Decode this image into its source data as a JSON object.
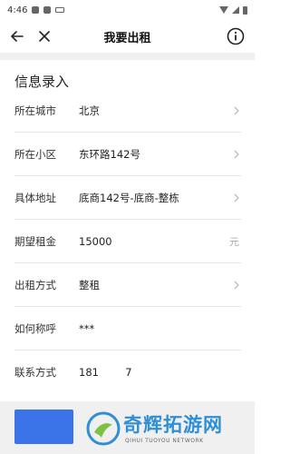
{
  "status_bar": {
    "time": "4:46"
  },
  "header": {
    "title": "我要出租"
  },
  "form": {
    "section_title": "信息录入",
    "rows": [
      {
        "label": "所在城市",
        "value": "北京",
        "has_chevron": true
      },
      {
        "label": "所在小区",
        "value": "东环路142号",
        "has_chevron": true
      },
      {
        "label": "具体地址",
        "value": "底商142号-底商-整栋",
        "has_chevron": true
      },
      {
        "label": "期望租金",
        "value": "15000",
        "unit": "元"
      },
      {
        "label": "出租方式",
        "value": "整租",
        "has_chevron": true
      },
      {
        "label": "如何称呼",
        "value": "***"
      },
      {
        "label": "联系方式",
        "value": "181        7"
      }
    ]
  },
  "watermark": {
    "main": "奇辉拓游网",
    "sub": "QIHUI TUOYOU NETWORK"
  },
  "colors": {
    "accent": "#3b73e8",
    "watermark": "#2e8ed6"
  }
}
